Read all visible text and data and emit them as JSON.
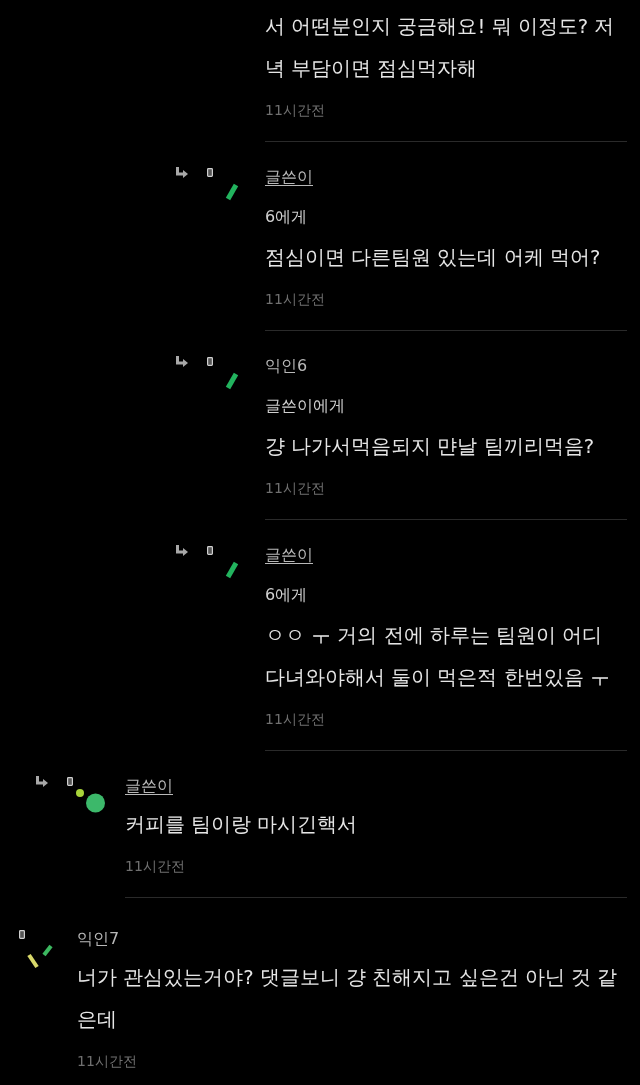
{
  "comments": [
    {
      "children": [
        {
          "children": [
            {
              "body": "서 어떤분인지 궁금해요! 뭐 이정도? 저녁 부담이면 점심먹자해",
              "time": "11시간전"
            },
            {
              "author": "글쓴이",
              "is_writer": true,
              "avatar": {
                "kind": "bar"
              },
              "mention": "6에게",
              "body": "점심이면 다른팀원 있는데 어케 먹어?",
              "time": "11시간전"
            },
            {
              "author": "익인6",
              "is_writer": false,
              "avatar": {
                "kind": "bar"
              },
              "mention": "글쓴이에게",
              "body": "걍 나가서먹음되지 먄날 팀끼리먹음?",
              "time": "11시간전"
            },
            {
              "author": "글쓴이",
              "is_writer": true,
              "avatar": {
                "kind": "bar"
              },
              "mention": "6에게",
              "body": "ㅇㅇ ㅜ 거의 전에 하루는 팀원이 어디 다녀와야해서 둘이 먹은적 한번있음 ㅜ",
              "time": "11시간전"
            }
          ]
        },
        {
          "author": "글쓴이",
          "is_writer": true,
          "avatar": {
            "kind": "dots"
          },
          "body": "커피를 팀이랑 마시긴핵서",
          "time": "11시간전"
        }
      ]
    },
    {
      "author": "익인7",
      "is_writer": false,
      "avatar": {
        "kind": "sticks"
      },
      "body": "너가 관심있는거야? 댓글보니 걍 친해지고 싶은건 아닌 것 같은데",
      "time": "11시간전"
    }
  ]
}
